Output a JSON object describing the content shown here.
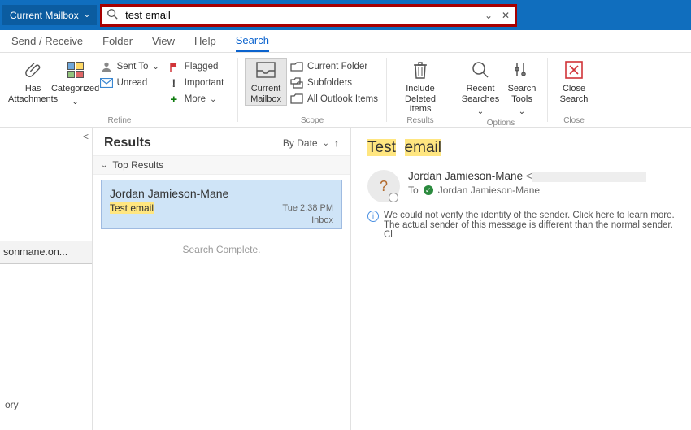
{
  "titlebar": {
    "scope": "Current Mailbox",
    "search_value": "test email"
  },
  "tabs": {
    "send_receive": "Send / Receive",
    "folder": "Folder",
    "view": "View",
    "help": "Help",
    "search": "Search"
  },
  "ribbon": {
    "has_attachments": "Has Attachments",
    "categorized": "Categorized",
    "sent_to": "Sent To",
    "flagged": "Flagged",
    "important": "Important",
    "unread": "Unread",
    "more": "More",
    "refine_group": "Refine",
    "current_mailbox": "Current Mailbox",
    "current_folder": "Current Folder",
    "subfolders": "Subfolders",
    "all_outlook": "All Outlook Items",
    "scope_group": "Scope",
    "include_deleted": "Include Deleted Items",
    "results_group": "Results",
    "recent_searches": "Recent Searches",
    "search_tools": "Search Tools",
    "options_group": "Options",
    "close_search": "Close Search",
    "close_group": "Close"
  },
  "left": {
    "account": "sonmane.on...",
    "history": "ory"
  },
  "list": {
    "heading": "Results",
    "sort": "By Date",
    "top_results": "Top Results",
    "items": [
      {
        "from": "Jordan Jamieson-Mane",
        "subject": "Test email",
        "time": "Tue 2:38 PM",
        "folder": "Inbox"
      }
    ],
    "complete": "Search Complete."
  },
  "reading": {
    "subject_w1": "Test",
    "subject_w2": "email",
    "avatar_initial": "?",
    "from_name": "Jordan Jamieson-Mane",
    "to_label": "To",
    "to_name": "Jordan Jamieson-Mane",
    "info_line1": "We could not verify the identity of the sender. Click here to learn more.",
    "info_line2": "The actual sender of this message is different than the normal sender. Cl"
  }
}
